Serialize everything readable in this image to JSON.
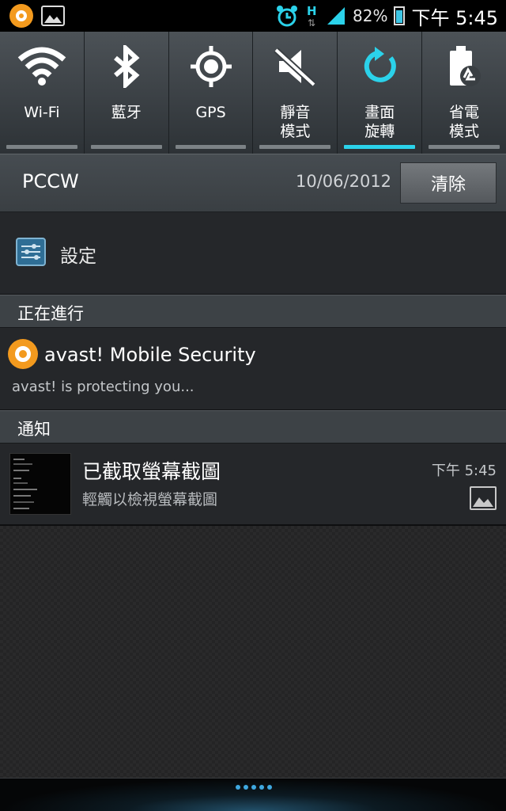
{
  "status_bar": {
    "network_type": "H",
    "battery_percent": "82%",
    "time": "下午 5:45"
  },
  "quick_toggles": [
    {
      "id": "wifi",
      "label": "Wi-Fi",
      "icon": "wifi-icon",
      "active": false
    },
    {
      "id": "bluetooth",
      "label": "藍牙",
      "icon": "bluetooth-icon",
      "active": false
    },
    {
      "id": "gps",
      "label": "GPS",
      "icon": "gps-icon",
      "active": false
    },
    {
      "id": "silent",
      "label": "靜音\n模式",
      "icon": "mute-icon",
      "active": false
    },
    {
      "id": "rotation",
      "label": "畫面\n旋轉",
      "icon": "rotate-icon",
      "active": true
    },
    {
      "id": "power_saving",
      "label": "省電\n模式",
      "icon": "power-saving-icon",
      "active": false
    }
  ],
  "carrier_row": {
    "carrier": "PCCW",
    "date": "10/06/2012",
    "clear_label": "清除"
  },
  "settings_item": {
    "label": "設定"
  },
  "ongoing_section": {
    "header": "正在進行",
    "item": {
      "title": "avast! Mobile Security",
      "subtitle": "avast! is protecting you..."
    }
  },
  "notifications_section": {
    "header": "通知",
    "item": {
      "title": "已截取螢幕截圖",
      "subtitle": "輕觸以檢視螢幕截圖",
      "time": "下午 5:45"
    }
  },
  "colors": {
    "accent": "#2bd2ea",
    "avast_orange": "#f39a1e"
  }
}
